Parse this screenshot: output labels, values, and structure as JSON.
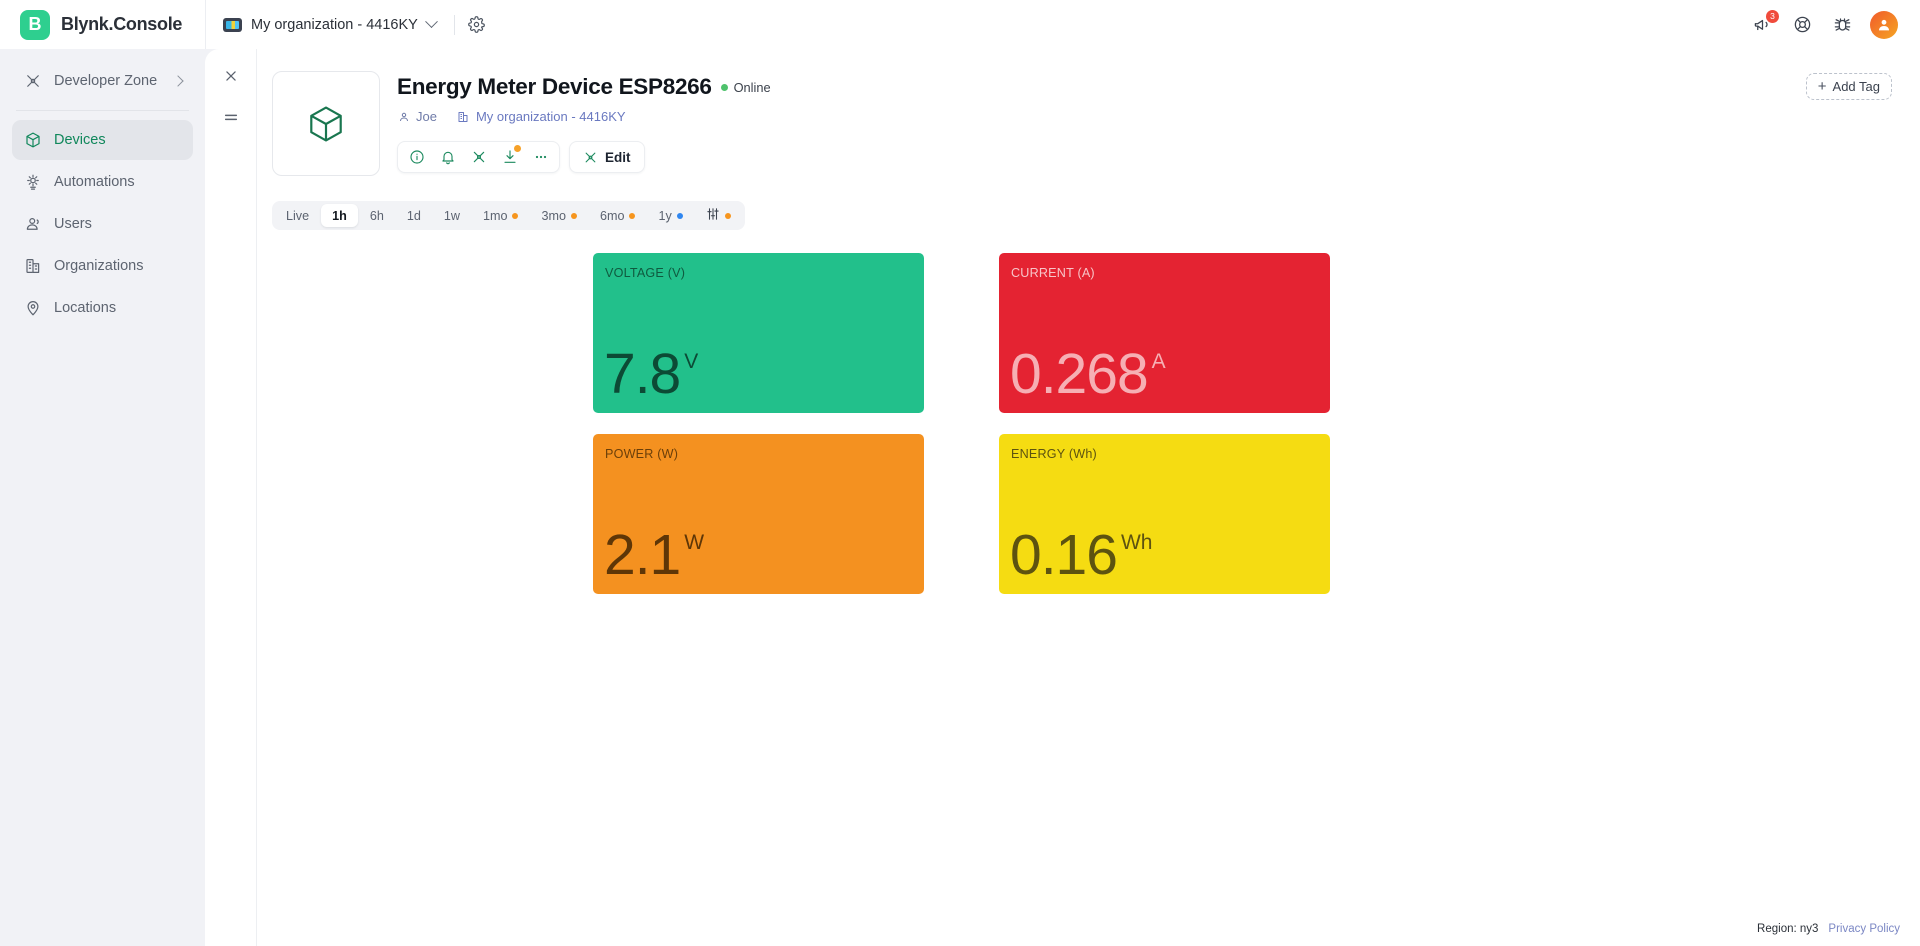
{
  "brand": {
    "logo_letter": "B",
    "name": "Blynk.Console"
  },
  "topbar": {
    "org_selector": {
      "label": "My organization - 4416KY",
      "icon": "org-thumbnail-icon",
      "chevron": "chevron-down-icon"
    },
    "settings_icon": "gear-icon",
    "actions": [
      {
        "name": "announcements",
        "icon": "megaphone-icon",
        "badge": "3"
      },
      {
        "name": "help",
        "icon": "lifebuoy-icon",
        "badge": ""
      },
      {
        "name": "report-bug",
        "icon": "bug-icon",
        "badge": ""
      }
    ],
    "avatar": "user-avatar-icon"
  },
  "sidebar": {
    "developer_zone": {
      "label": "Developer Zone",
      "icon": "developer-zone-icon",
      "chevron": "chevron-right-icon"
    },
    "items": [
      {
        "label": "Devices",
        "icon": "cube-icon",
        "active": true
      },
      {
        "label": "Automations",
        "icon": "automations-icon",
        "active": false
      },
      {
        "label": "Users",
        "icon": "users-icon",
        "active": false
      },
      {
        "label": "Organizations",
        "icon": "organizations-icon",
        "active": false
      },
      {
        "label": "Locations",
        "icon": "location-pin-icon",
        "active": false
      }
    ]
  },
  "rail": {
    "close_icon": "close-icon",
    "list_icon": "list-menu-icon"
  },
  "device": {
    "thumbnail_icon": "cube-outline-icon",
    "title": "Energy Meter Device ESP8266",
    "status": "Online",
    "owner": {
      "label": "Joe",
      "icon": "user-icon"
    },
    "organization": {
      "label": "My organization - 4416KY",
      "icon": "building-icon"
    },
    "toolbar": [
      {
        "name": "info",
        "icon": "info-circle-icon",
        "dot": false
      },
      {
        "name": "notifications",
        "icon": "bell-icon",
        "dot": false
      },
      {
        "name": "developer",
        "icon": "developer-zone-icon",
        "dot": false
      },
      {
        "name": "download",
        "icon": "download-icon",
        "dot": true
      },
      {
        "name": "more",
        "icon": "ellipsis-icon",
        "dot": false
      }
    ],
    "edit_label": "Edit",
    "edit_icon": "edit-wrench-icon",
    "add_tag_label": "Add Tag",
    "add_tag_icon": "plus-icon"
  },
  "time_tabs": [
    {
      "label": "Live",
      "selected": false,
      "dot": ""
    },
    {
      "label": "1h",
      "selected": true,
      "dot": ""
    },
    {
      "label": "6h",
      "selected": false,
      "dot": ""
    },
    {
      "label": "1d",
      "selected": false,
      "dot": ""
    },
    {
      "label": "1w",
      "selected": false,
      "dot": ""
    },
    {
      "label": "1mo",
      "selected": false,
      "dot": "#f6951e"
    },
    {
      "label": "3mo",
      "selected": false,
      "dot": "#f6951e"
    },
    {
      "label": "6mo",
      "selected": false,
      "dot": "#f6951e"
    },
    {
      "label": "1y",
      "selected": false,
      "dot": "#2f86f0"
    },
    {
      "label": "",
      "selected": false,
      "dot": "#f6951e",
      "icon": "sliders-icon"
    }
  ],
  "widgets": [
    {
      "label": "VOLTAGE (V)",
      "value": "7.8",
      "unit": "V",
      "bg": "#22c08b",
      "fg": "#0c4a35",
      "label_fg": "#0f5a3f"
    },
    {
      "label": "CURRENT (A)",
      "value": "0.268",
      "unit": "A",
      "bg": "#e42332",
      "fg": "#f6afb4",
      "label_fg": "#f7c4c8"
    },
    {
      "label": "POWER (W)",
      "value": "2.1",
      "unit": "W",
      "bg": "#f49120",
      "fg": "#5e3607",
      "label_fg": "#6b3f09"
    },
    {
      "label": "ENERGY (Wh)",
      "value": "0.16",
      "unit": "Wh",
      "bg": "#f5dc12",
      "fg": "#5d5310",
      "label_fg": "#5d5310"
    }
  ],
  "footer": {
    "region": "Region: ny3",
    "privacy": "Privacy Policy"
  }
}
